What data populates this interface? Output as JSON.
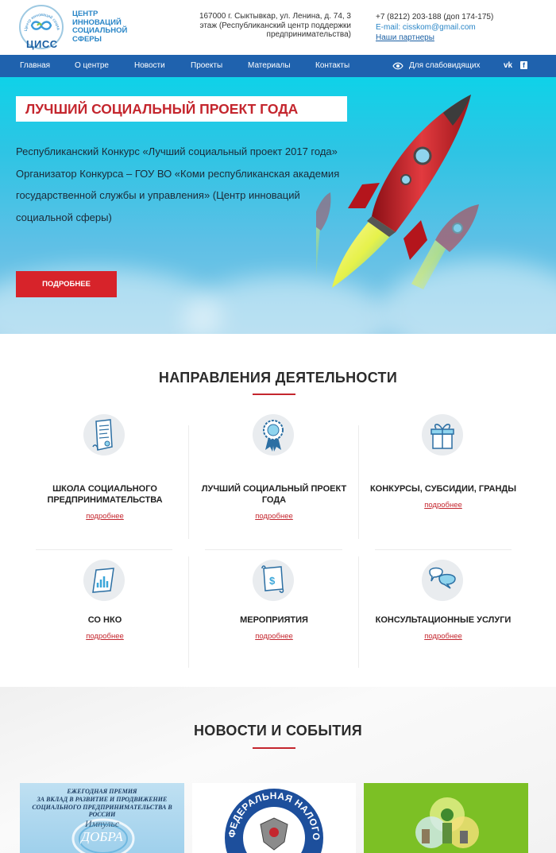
{
  "header": {
    "logo_abbr": "ЦИСС",
    "logo_arc": "Центр инноваций социальной сферы",
    "logo_name": [
      "ЦЕНТР",
      "ИННОВАЦИЙ",
      "СОЦИАЛЬНОЙ",
      "СФЕРЫ"
    ],
    "address": "167000 г. Сыктывкар, ул. Ленина, д. 74, 3 этаж (Республиканский центр поддержки предпринимательства)",
    "phone": "+7 (8212) 203-188 (доп 174-175)",
    "email": "E-mail: cisskom@gmail.com",
    "partners": "Наши партнеры"
  },
  "nav": {
    "items": [
      "Главная",
      "О центре",
      "Новости",
      "Проекты",
      "Материалы",
      "Контакты"
    ],
    "accessibility": "Для слабовидящих",
    "vk": "vk",
    "fb": "f"
  },
  "hero": {
    "title": "ЛУЧШИЙ СОЦИАЛЬНЫЙ ПРОЕКТ ГОДА",
    "text1": "Республиканский Конкурс «Лучший социальный проект 2017 года»",
    "text2": "Организатор Конкурса – ГОУ ВО «Коми республиканская академия государственной службы и управления» (Центр инноваций социальной сферы)",
    "button": "ПОДРОБНЕЕ"
  },
  "directions": {
    "title": "НАПРАВЛЕНИЯ ДЕЯТЕЛЬНОСТИ",
    "link_label": "подробнее",
    "items": [
      {
        "title": "ШКОЛА СОЦИАЛЬНОГО ПРЕДПРИНИМАТЕЛЬСТВА",
        "icon": "scroll-icon"
      },
      {
        "title": "ЛУЧШИЙ СОЦИАЛЬНЫЙ ПРОЕКТ ГОДА",
        "icon": "award-rosette-icon"
      },
      {
        "title": "КОНКУРСЫ, СУБСИДИИ, ГРАНДЫ",
        "icon": "gift-box-icon"
      },
      {
        "title": "СО НКО",
        "icon": "chart-document-icon"
      },
      {
        "title": "МЕРОПРИЯТИЯ",
        "icon": "calendar-scroll-icon"
      },
      {
        "title": "КОНСУЛЬТАЦИОННЫЕ УСЛУГИ",
        "icon": "chat-bubbles-icon"
      }
    ]
  },
  "news": {
    "title": "НОВОСТИ И СОБЫТИЯ",
    "card1": {
      "line1": "ЕЖЕГОДНАЯ ПРЕМИЯ",
      "line2": "ЗА ВКЛАД В РАЗВИТИЕ И ПРОДВИЖЕНИЕ",
      "line3": "СОЦИАЛЬНОГО ПРЕДПРИНИМАТЕЛЬСТВА В РОССИИ",
      "script1": "Импульс",
      "script2": "ДОБРА"
    },
    "card2": {
      "seal_text": "ФЕДЕРАЛЬНАЯ НАЛОГОВАЯ СЛУЖБА"
    }
  },
  "colors": {
    "accent_red": "#c4262e",
    "nav_blue": "#1f62ae",
    "link_blue": "#2a86c7"
  }
}
